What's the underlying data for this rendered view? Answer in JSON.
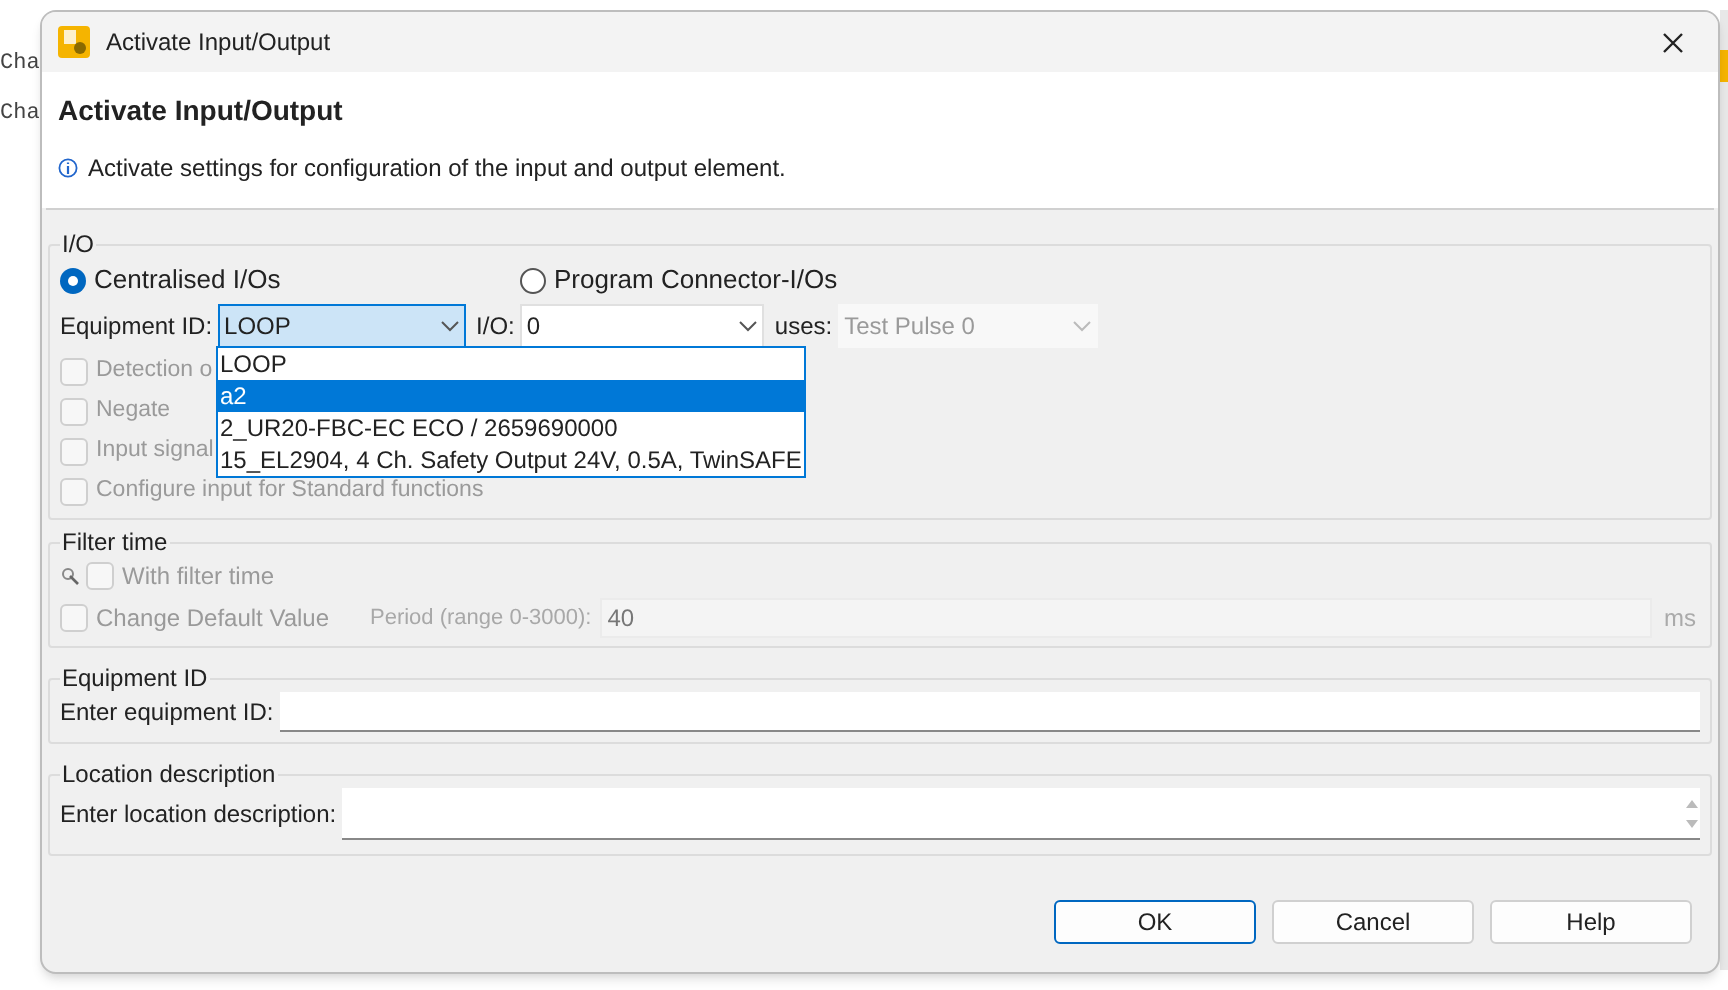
{
  "background_text": [
    "Cha",
    "Cha"
  ],
  "window": {
    "title": "Activate Input/Output"
  },
  "header": {
    "title": "Activate Input/Output",
    "info": "Activate settings for configuration of the input and output element."
  },
  "io_group": {
    "label": "I/O",
    "radios": [
      {
        "label": "Centralised I/Os",
        "selected": true
      },
      {
        "label": "Program Connector-I/Os",
        "selected": false
      }
    ],
    "equipment_label": "Equipment ID:",
    "equipment_value": "LOOP",
    "io_label": "I/O:",
    "io_value": "0",
    "uses_label": "uses:",
    "uses_value": "Test Pulse 0",
    "uses_disabled": true,
    "dropdown_open": true,
    "options": [
      {
        "label": "LOOP",
        "selected": false
      },
      {
        "label": "a2",
        "selected": true
      },
      {
        "label": "2_UR20-FBC-EC ECO / 2659690000",
        "selected": false
      },
      {
        "label": "15_EL2904, 4 Ch. Safety Output 24V, 0.5A, TwinSAFE",
        "selected": false
      }
    ],
    "checkboxes": [
      {
        "label": "Detection o",
        "checked": false,
        "disabled": true
      },
      {
        "label": "Negate",
        "checked": false,
        "disabled": true
      },
      {
        "label": "Input signal",
        "checked": false,
        "disabled": true
      },
      {
        "label": "Configure input for Standard functions",
        "checked": false,
        "disabled": true
      }
    ]
  },
  "filter_group": {
    "label": "Filter time",
    "with_filter": {
      "label": "With filter time",
      "checked": false,
      "disabled": true
    },
    "change_default": {
      "label": "Change Default Value",
      "checked": false,
      "disabled": true
    },
    "period_label": "Period (range 0-3000):",
    "period_value": "40",
    "unit": "ms"
  },
  "equipment_group": {
    "label": "Equipment ID",
    "field_label": "Enter equipment ID:"
  },
  "location_group": {
    "label": "Location description",
    "field_label": "Enter location description:"
  },
  "buttons": [
    {
      "label": "OK",
      "default": true
    },
    {
      "label": "Cancel",
      "default": false
    },
    {
      "label": "Help",
      "default": false
    }
  ]
}
